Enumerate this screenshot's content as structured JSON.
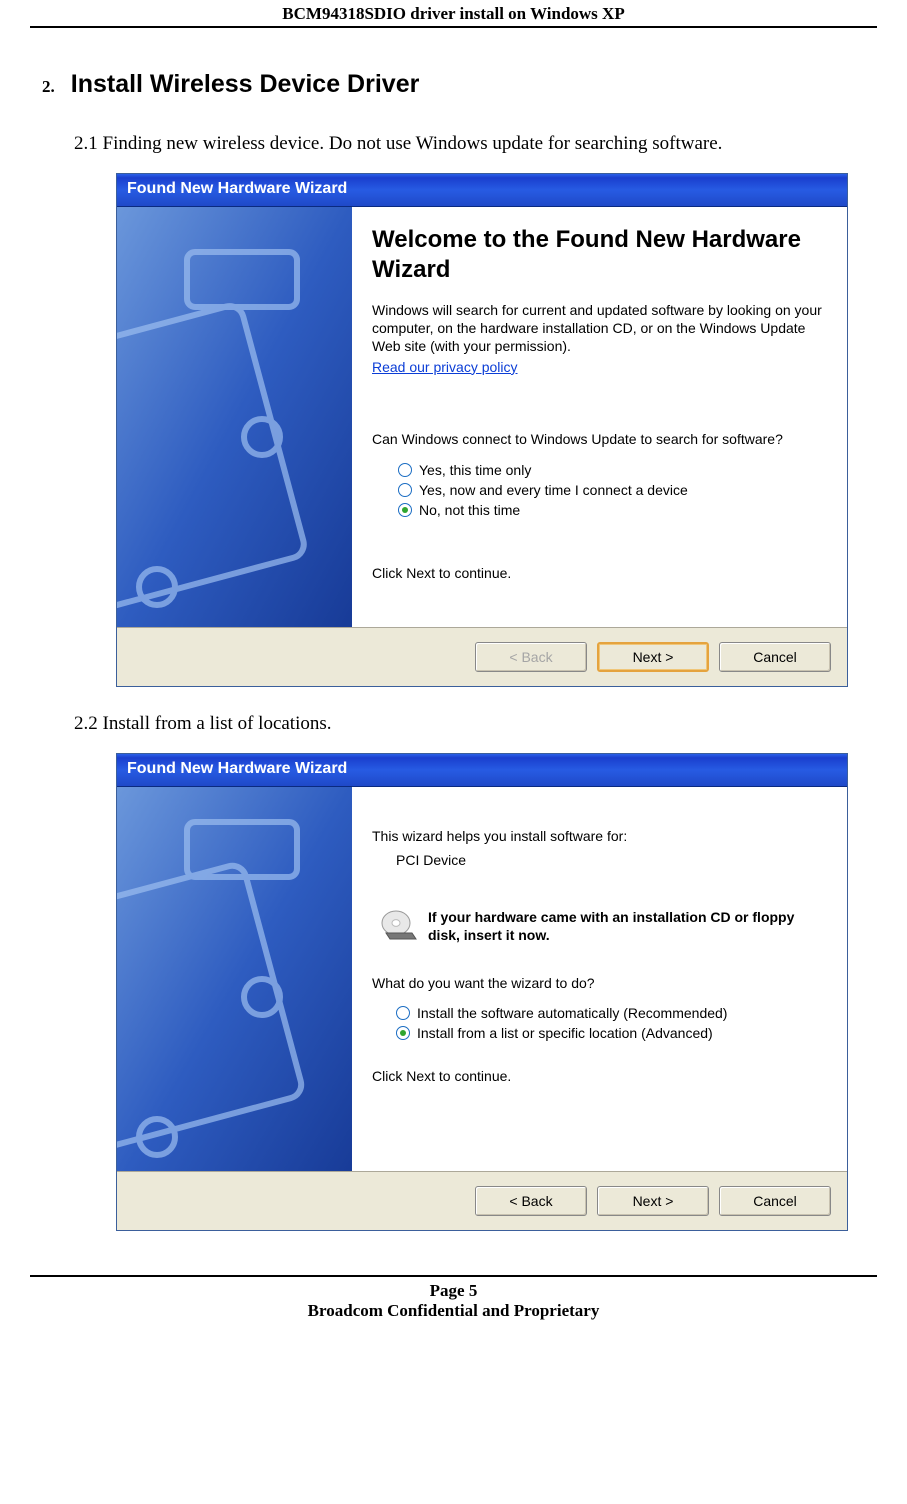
{
  "doc": {
    "header_title": "BCM94318SDIO driver install on Windows XP",
    "section_num": "2.",
    "section_title": "Install Wireless Device Driver",
    "step21": "2.1 Finding new wireless device. Do not use Windows update for searching software.",
    "step22": "2.2 Install from a list of locations.",
    "page_label": "Page 5",
    "footer_notice": "Broadcom Confidential and Proprietary"
  },
  "dialog1": {
    "title": "Found New Hardware Wizard",
    "heading": "Welcome to the Found New Hardware Wizard",
    "intro": "Windows will search for current and updated software by looking on your computer, on the hardware installation CD, or on the Windows Update Web site (with your permission).",
    "privacy_link": "Read our privacy policy",
    "question": "Can Windows connect to Windows Update to search for software?",
    "options": [
      {
        "label": "Yes, this time only",
        "checked": false
      },
      {
        "label": "Yes, now and every time I connect a device",
        "checked": false
      },
      {
        "label": "No, not this time",
        "checked": true
      }
    ],
    "click_next": "Click Next to continue.",
    "buttons": {
      "back": "< Back",
      "next": "Next >",
      "cancel": "Cancel"
    }
  },
  "dialog2": {
    "title": "Found New Hardware Wizard",
    "intro": "This wizard helps you install software for:",
    "device_name": "PCI Device",
    "cd_notice": "If your hardware came with an installation CD or floppy disk, insert it now.",
    "what_do": "What do you want the wizard to do?",
    "options": [
      {
        "label": "Install the software automatically (Recommended)",
        "checked": false
      },
      {
        "label": "Install from a list or specific location (Advanced)",
        "checked": true
      }
    ],
    "click_next": "Click Next to continue.",
    "buttons": {
      "back": "< Back",
      "next": "Next >",
      "cancel": "Cancel"
    }
  }
}
